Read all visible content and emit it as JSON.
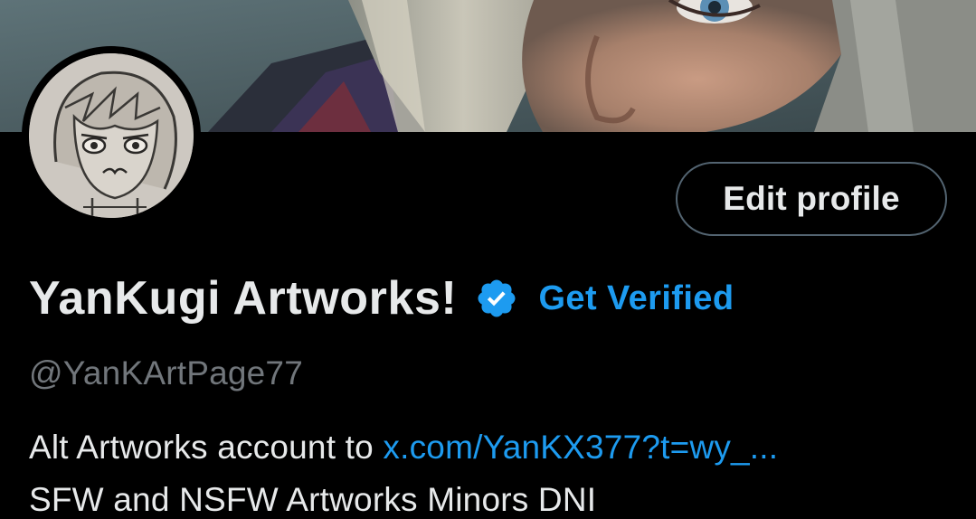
{
  "colors": {
    "background": "#000000",
    "text_primary": "#e7e9ea",
    "text_secondary": "#71767b",
    "accent": "#1d9bf0",
    "button_border": "#536471"
  },
  "banner": {
    "icon": "banner-image"
  },
  "avatar": {
    "icon": "avatar-sketch-image"
  },
  "profile": {
    "edit_button_label": "Edit profile",
    "display_name": "YanKugi Artworks!",
    "verified_icon": "verified-badge-icon",
    "get_verified_label": "Get Verified",
    "handle": "@YanKArtPage77"
  },
  "bio": {
    "line1_prefix": "Alt Artworks account to ",
    "line1_link": "x.com/YanKX377?t=wy_...",
    "line2": "SFW and NSFW Artworks Minors DNI"
  }
}
